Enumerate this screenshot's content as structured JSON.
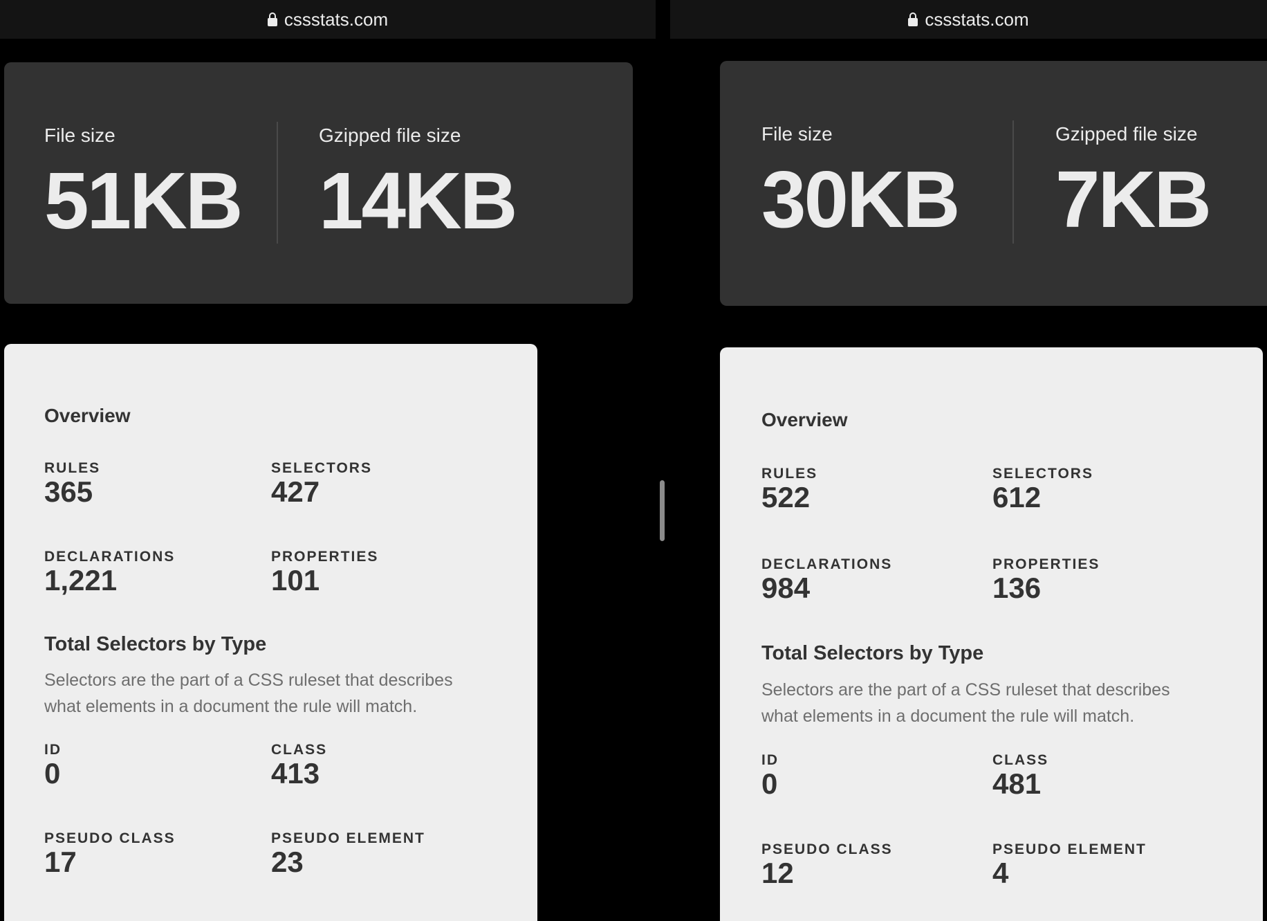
{
  "left": {
    "url": "cssstats.com",
    "sizes": {
      "file_size_label": "File size",
      "file_size_value": "51KB",
      "gzip_label": "Gzipped file size",
      "gzip_value": "14KB"
    },
    "overview": {
      "title": "Overview",
      "rules_label": "RULES",
      "rules_value": "365",
      "selectors_label": "SELECTORS",
      "selectors_value": "427",
      "declarations_label": "DECLARATIONS",
      "declarations_value": "1,221",
      "properties_label": "PROPERTIES",
      "properties_value": "101"
    },
    "selectors_by_type": {
      "title": "Total Selectors by Type",
      "description": "Selectors are the part of a CSS ruleset that describes what elements in a document the rule will match.",
      "id_label": "ID",
      "id_value": "0",
      "class_label": "CLASS",
      "class_value": "413",
      "pseudo_class_label": "PSEUDO CLASS",
      "pseudo_class_value": "17",
      "pseudo_element_label": "PSEUDO ELEMENT",
      "pseudo_element_value": "23"
    }
  },
  "right": {
    "url": "cssstats.com",
    "sizes": {
      "file_size_label": "File size",
      "file_size_value": "30KB",
      "gzip_label": "Gzipped file size",
      "gzip_value": "7KB"
    },
    "overview": {
      "title": "Overview",
      "rules_label": "RULES",
      "rules_value": "522",
      "selectors_label": "SELECTORS",
      "selectors_value": "612",
      "declarations_label": "DECLARATIONS",
      "declarations_value": "984",
      "properties_label": "PROPERTIES",
      "properties_value": "136"
    },
    "selectors_by_type": {
      "title": "Total Selectors by Type",
      "description": "Selectors are the part of a CSS ruleset that describes what elements in a document the rule will match.",
      "id_label": "ID",
      "id_value": "0",
      "class_label": "CLASS",
      "class_value": "481",
      "pseudo_class_label": "PSEUDO CLASS",
      "pseudo_class_value": "12",
      "pseudo_element_label": "PSEUDO ELEMENT",
      "pseudo_element_value": "4"
    }
  },
  "icons": {
    "url_lock": "lock-icon"
  }
}
